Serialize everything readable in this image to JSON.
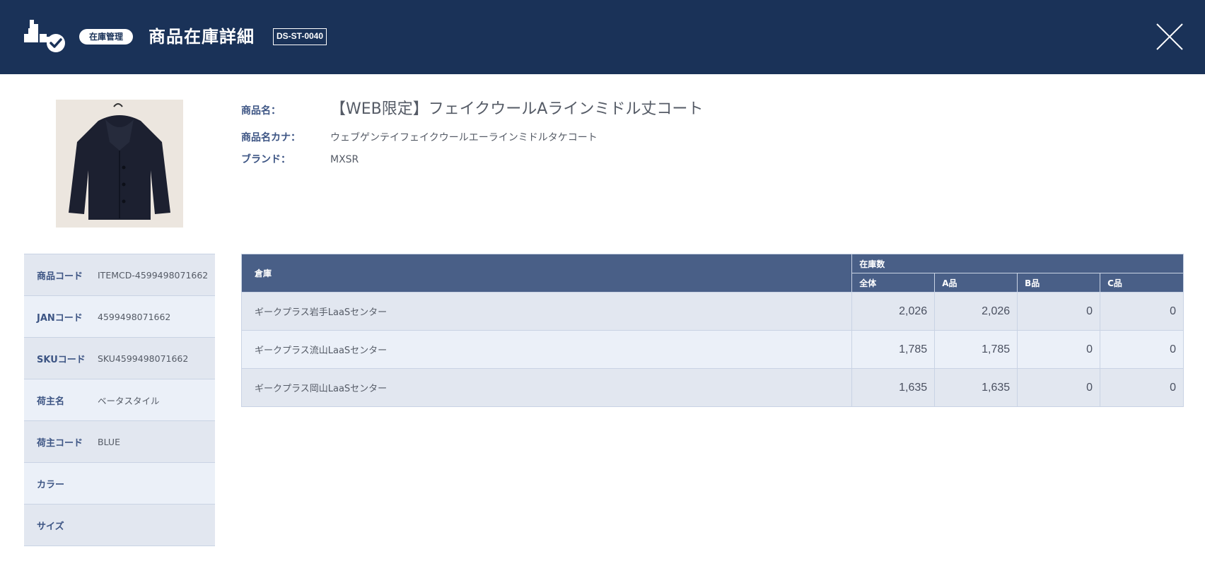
{
  "header": {
    "module_badge": "在庫管理",
    "title": "商品在庫詳細",
    "screen_id": "DS-ST-0040"
  },
  "icons": {
    "logo": "warehouse-check-icon",
    "close": "close-icon"
  },
  "colors": {
    "header_bg": "#1a3258",
    "table_header_bg": "#495f87",
    "label_color": "#3d5584",
    "row_odd": "#e2e7f0",
    "row_even": "#ebf0f8"
  },
  "product": {
    "name_label": "商品名：",
    "name": "【WEB限定】フェイクウールAラインミドル丈コート",
    "kana_label": "商品名カナ：",
    "kana": "ウェブゲンテイフェイクウールエーラインミドルタケコート",
    "brand_label": "ブランド：",
    "brand": "MXSR"
  },
  "attributes": [
    {
      "label": "商品コード",
      "value": "ITEMCD-4599498071662"
    },
    {
      "label": "JANコード",
      "value": "4599498071662"
    },
    {
      "label": "SKUコード",
      "value": "SKU4599498071662"
    },
    {
      "label": "荷主名",
      "value": "ベータスタイル"
    },
    {
      "label": "荷主コード",
      "value": "BLUE"
    },
    {
      "label": "カラー",
      "value": ""
    },
    {
      "label": "サイズ",
      "value": ""
    }
  ],
  "stock_table": {
    "headers": {
      "warehouse": "倉庫",
      "stock_group": "在庫数",
      "total": "全体",
      "a": "A品",
      "b": "B品",
      "c": "C品"
    },
    "rows": [
      {
        "warehouse": "ギークプラス岩手LaaSセンター",
        "total": "2,026",
        "a": "2,026",
        "b": "0",
        "c": "0"
      },
      {
        "warehouse": "ギークプラス流山LaaSセンター",
        "total": "1,785",
        "a": "1,785",
        "b": "0",
        "c": "0"
      },
      {
        "warehouse": "ギークプラス岡山LaaSセンター",
        "total": "1,635",
        "a": "1,635",
        "b": "0",
        "c": "0"
      }
    ]
  }
}
